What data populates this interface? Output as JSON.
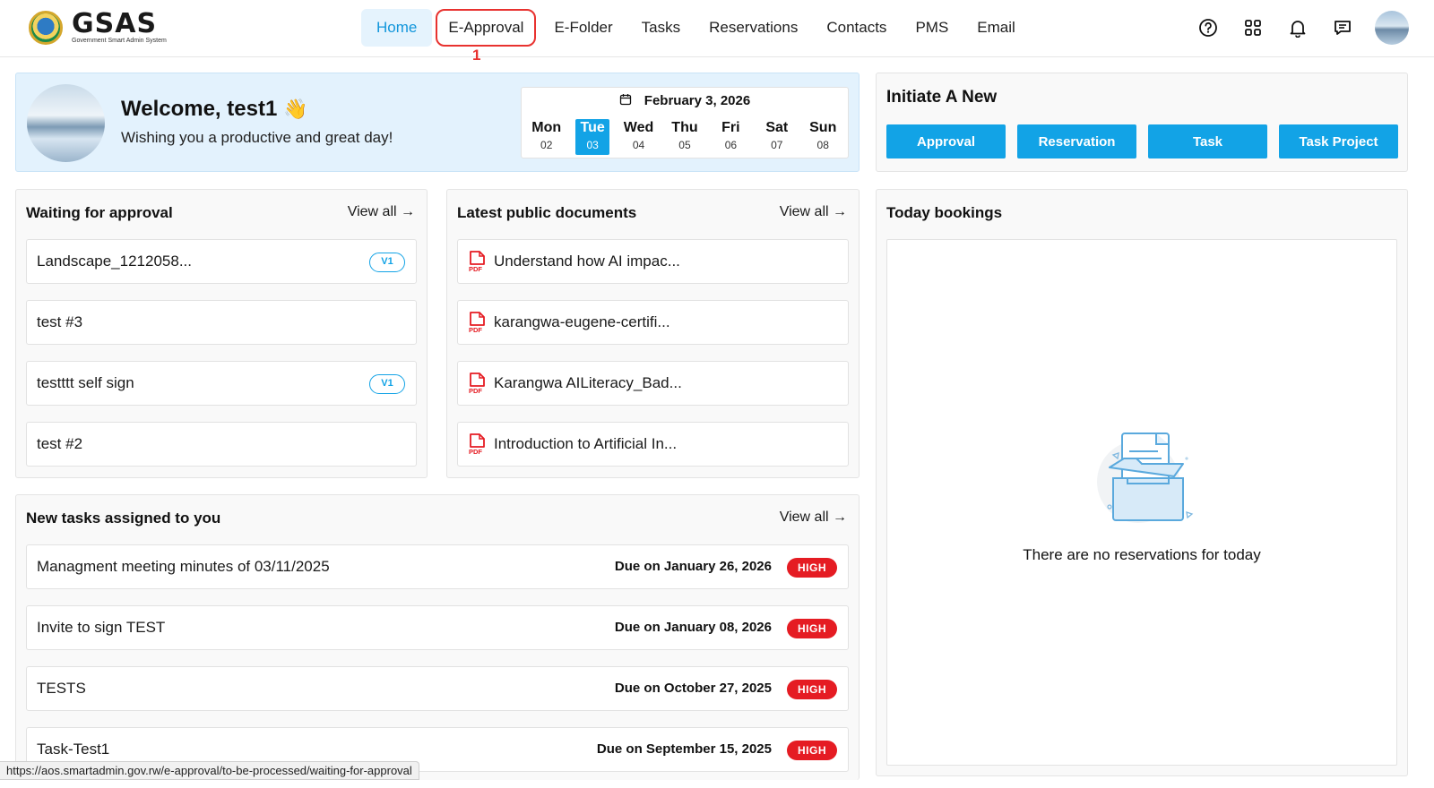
{
  "brand": {
    "name": "GSAS",
    "subtitle": "Government Smart Admin System"
  },
  "nav": {
    "items": [
      "Home",
      "E-Approval",
      "E-Folder",
      "Tasks",
      "Reservations",
      "Contacts",
      "PMS",
      "Email"
    ],
    "active": "Home",
    "marker": "1"
  },
  "header_icons": [
    "help-icon",
    "apps-grid-icon",
    "bell-icon",
    "chat-icon"
  ],
  "welcome": {
    "title": "Welcome, test1",
    "wave": "👋",
    "subtitle": "Wishing you a productive and great day!"
  },
  "calendar": {
    "date": "February 3, 2026",
    "days": [
      {
        "name": "Mon",
        "num": "02"
      },
      {
        "name": "Tue",
        "num": "03"
      },
      {
        "name": "Wed",
        "num": "04"
      },
      {
        "name": "Thu",
        "num": "05"
      },
      {
        "name": "Fri",
        "num": "06"
      },
      {
        "name": "Sat",
        "num": "07"
      },
      {
        "name": "Sun",
        "num": "08"
      }
    ],
    "selected": "Tue"
  },
  "initiate": {
    "title": "Initiate A New",
    "buttons": [
      "Approval",
      "Reservation",
      "Task",
      "Task Project"
    ]
  },
  "waiting": {
    "title": "Waiting for approval",
    "view_all": "View all →",
    "items": [
      {
        "label": "Landscape_1212058...",
        "badge": "V1"
      },
      {
        "label": "test #3",
        "badge": ""
      },
      {
        "label": "testttt self sign",
        "badge": "V1"
      },
      {
        "label": "test #2",
        "badge": ""
      }
    ]
  },
  "docs": {
    "title": "Latest public documents",
    "view_all": "View all →",
    "items": [
      "Understand how AI impac...",
      "karangwa-eugene-certifi...",
      "Karangwa AILiteracy_Bad...",
      "Introduction to Artificial In..."
    ]
  },
  "tasks": {
    "title": "New tasks assigned to you",
    "view_all": "View all →",
    "items": [
      {
        "label": "Managment meeting minutes of 03/11/2025",
        "due": "Due on January 26, 2026",
        "priority": "HIGH"
      },
      {
        "label": "Invite to sign TEST",
        "due": "Due on January 08, 2026",
        "priority": "HIGH"
      },
      {
        "label": "TESTS",
        "due": "Due on October 27, 2025",
        "priority": "HIGH"
      },
      {
        "label": "Task-Test1",
        "due": "Due on September 15, 2025",
        "priority": "HIGH"
      }
    ]
  },
  "bookings": {
    "title": "Today bookings",
    "empty": "There are no reservations for today"
  },
  "status_url": "https://aos.smartadmin.gov.rw/e-approval/to-be-processed/waiting-for-approval",
  "colors": {
    "accent": "#12a3e6",
    "priority_high": "#e51c23",
    "marker": "#e8322f",
    "welcome_bg": "#e3f2fd"
  }
}
